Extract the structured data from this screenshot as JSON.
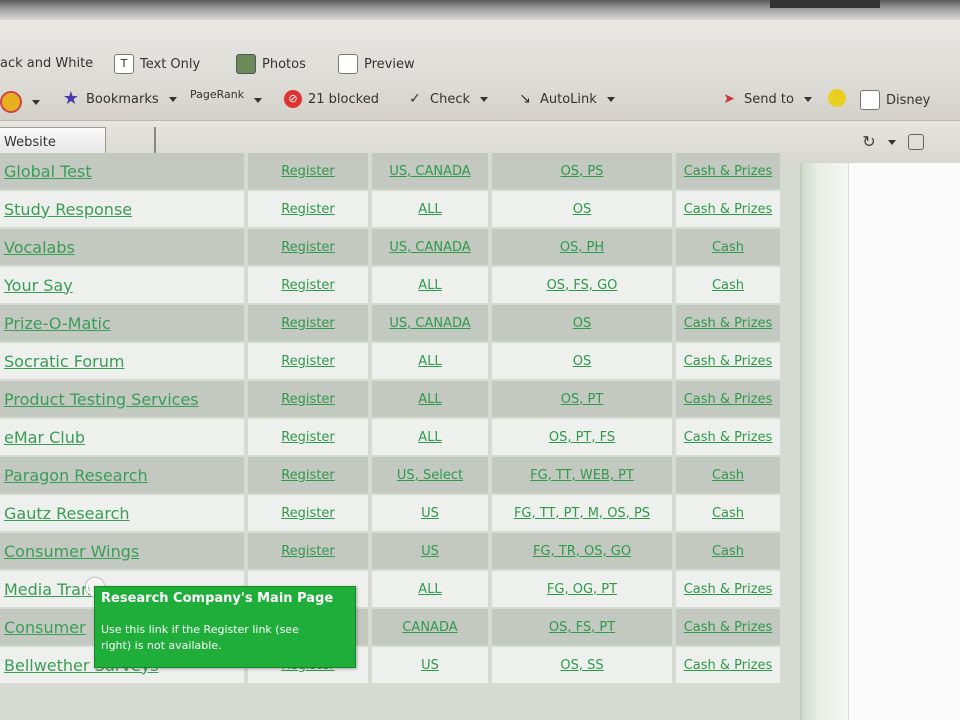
{
  "toolbar_top": {
    "black_white_label": "ack and White",
    "text_only_label": "Text Only",
    "photos_label": "Photos",
    "preview_label": "Preview"
  },
  "toolbar_mid": {
    "bookmarks_label": "Bookmarks",
    "pagerank_label": "PageRank",
    "blocked_label": "21 blocked",
    "check_label": "Check",
    "autolink_label": "AutoLink",
    "send_to_label": "Send to",
    "disney_label": "Disney"
  },
  "toolbar_low": {
    "tab_label": "Website"
  },
  "table": {
    "rows": [
      {
        "name": "Global Test",
        "reg": "Register",
        "region": "US, CANADA",
        "pay_type": "OS, PS",
        "reward": "Cash & Prizes"
      },
      {
        "name": "Study Response",
        "reg": "Register",
        "region": "ALL",
        "pay_type": "OS",
        "reward": "Cash & Prizes"
      },
      {
        "name": "Vocalabs",
        "reg": "Register",
        "region": "US, CANADA",
        "pay_type": "OS, PH",
        "reward": "Cash"
      },
      {
        "name": "Your Say",
        "reg": "Register",
        "region": "ALL",
        "pay_type": "OS, FS, GO",
        "reward": "Cash"
      },
      {
        "name": "Prize-O-Matic",
        "reg": "Register",
        "region": "US, CANADA",
        "pay_type": "OS",
        "reward": "Cash & Prizes"
      },
      {
        "name": "Socratic Forum",
        "reg": "Register",
        "region": "ALL",
        "pay_type": "OS",
        "reward": "Cash & Prizes"
      },
      {
        "name": "Product Testing Services",
        "reg": "Register",
        "region": "ALL",
        "pay_type": "OS, PT",
        "reward": "Cash & Prizes"
      },
      {
        "name": "eMar Club",
        "reg": "Register",
        "region": "ALL",
        "pay_type": "OS, PT, FS",
        "reward": "Cash & Prizes"
      },
      {
        "name": "Paragon Research",
        "reg": "Register",
        "region": "US, Select",
        "pay_type": "FG, TT, WEB, PT",
        "reward": "Cash"
      },
      {
        "name": "Gautz Research",
        "reg": "Register",
        "region": "US",
        "pay_type": "FG, TT, PT, M, OS, PS",
        "reward": "Cash"
      },
      {
        "name": "Consumer Wings",
        "reg": "Register",
        "region": "US",
        "pay_type": "FG, TR, OS, GO",
        "reward": "Cash"
      },
      {
        "name": "Media Tran",
        "reg": "",
        "region": "ALL",
        "pay_type": "FG, OG, PT",
        "reward": "Cash & Prizes"
      },
      {
        "name": "Consumer",
        "reg": "",
        "region": "CANADA",
        "pay_type": "OS, FS, PT",
        "reward": "Cash & Prizes"
      },
      {
        "name": "Bellwether Surveys",
        "reg": "Register",
        "region": "US",
        "pay_type": "OS, SS",
        "reward": "Cash & Prizes"
      }
    ]
  },
  "tooltip": {
    "title": "Research Company's Main Page",
    "body": "Use this link if the Register link (see right) is not available."
  },
  "colors": {
    "link_green": "#2f9a4a",
    "tooltip_green": "#1fae3a",
    "row_dark": "#c3c8c1",
    "row_light": "#eef0ed"
  }
}
